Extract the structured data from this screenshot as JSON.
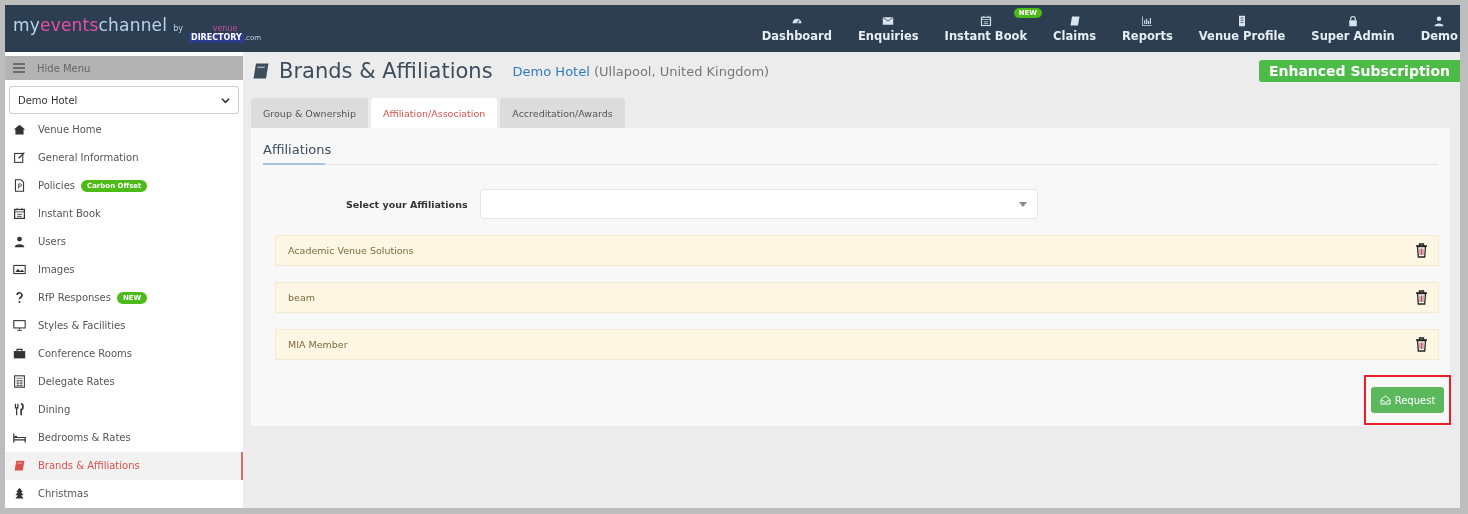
{
  "logo": {
    "lead": "my",
    "accent": "events",
    "tail": "channel",
    "by": "by",
    "brand_top": "venue",
    "brand": "DIRECTORY",
    "brand_suffix": ".com"
  },
  "nav": [
    {
      "label": "Dashboard"
    },
    {
      "label": "Enquiries"
    },
    {
      "label": "Instant Book",
      "badge": "NEW"
    },
    {
      "label": "Claims"
    },
    {
      "label": "Reports"
    },
    {
      "label": "Venue Profile"
    },
    {
      "label": "Super Admin"
    },
    {
      "label": "Demo"
    }
  ],
  "sidebar": {
    "toggle": "Hide Menu",
    "venue_select": "Demo Hotel",
    "items": [
      {
        "label": "Venue Home",
        "selected": false
      },
      {
        "label": "General Information",
        "selected": false
      },
      {
        "label": "Policies",
        "selected": false,
        "badge": "Carbon Offset"
      },
      {
        "label": "Instant Book",
        "selected": false
      },
      {
        "label": "Users",
        "selected": false
      },
      {
        "label": "Images",
        "selected": false
      },
      {
        "label": "RfP Responses",
        "selected": false,
        "badge": "NEW"
      },
      {
        "label": "Styles & Facilities",
        "selected": false
      },
      {
        "label": "Conference Rooms",
        "selected": false
      },
      {
        "label": "Delegate Rates",
        "selected": false
      },
      {
        "label": "Dining",
        "selected": false
      },
      {
        "label": "Bedrooms & Rates",
        "selected": false
      },
      {
        "label": "Brands & Affiliations",
        "selected": true
      },
      {
        "label": "Christmas",
        "selected": false
      }
    ]
  },
  "page": {
    "title": "Brands & Affiliations",
    "venue_name": "Demo Hotel",
    "venue_location": "(Ullapool, United Kingdom)",
    "subscription": "Enhanced Subscription"
  },
  "tabs": [
    {
      "label": "Group & Ownership",
      "selected": false
    },
    {
      "label": "Affiliation/Association",
      "selected": true
    },
    {
      "label": "Accreditation/Awards",
      "selected": false
    }
  ],
  "panel": {
    "heading": "Affiliations",
    "select_label": "Select your Affiliations",
    "affiliations": [
      "Academic Venue Solutions",
      "beam",
      "MIA Member"
    ],
    "request_button": "Request"
  }
}
